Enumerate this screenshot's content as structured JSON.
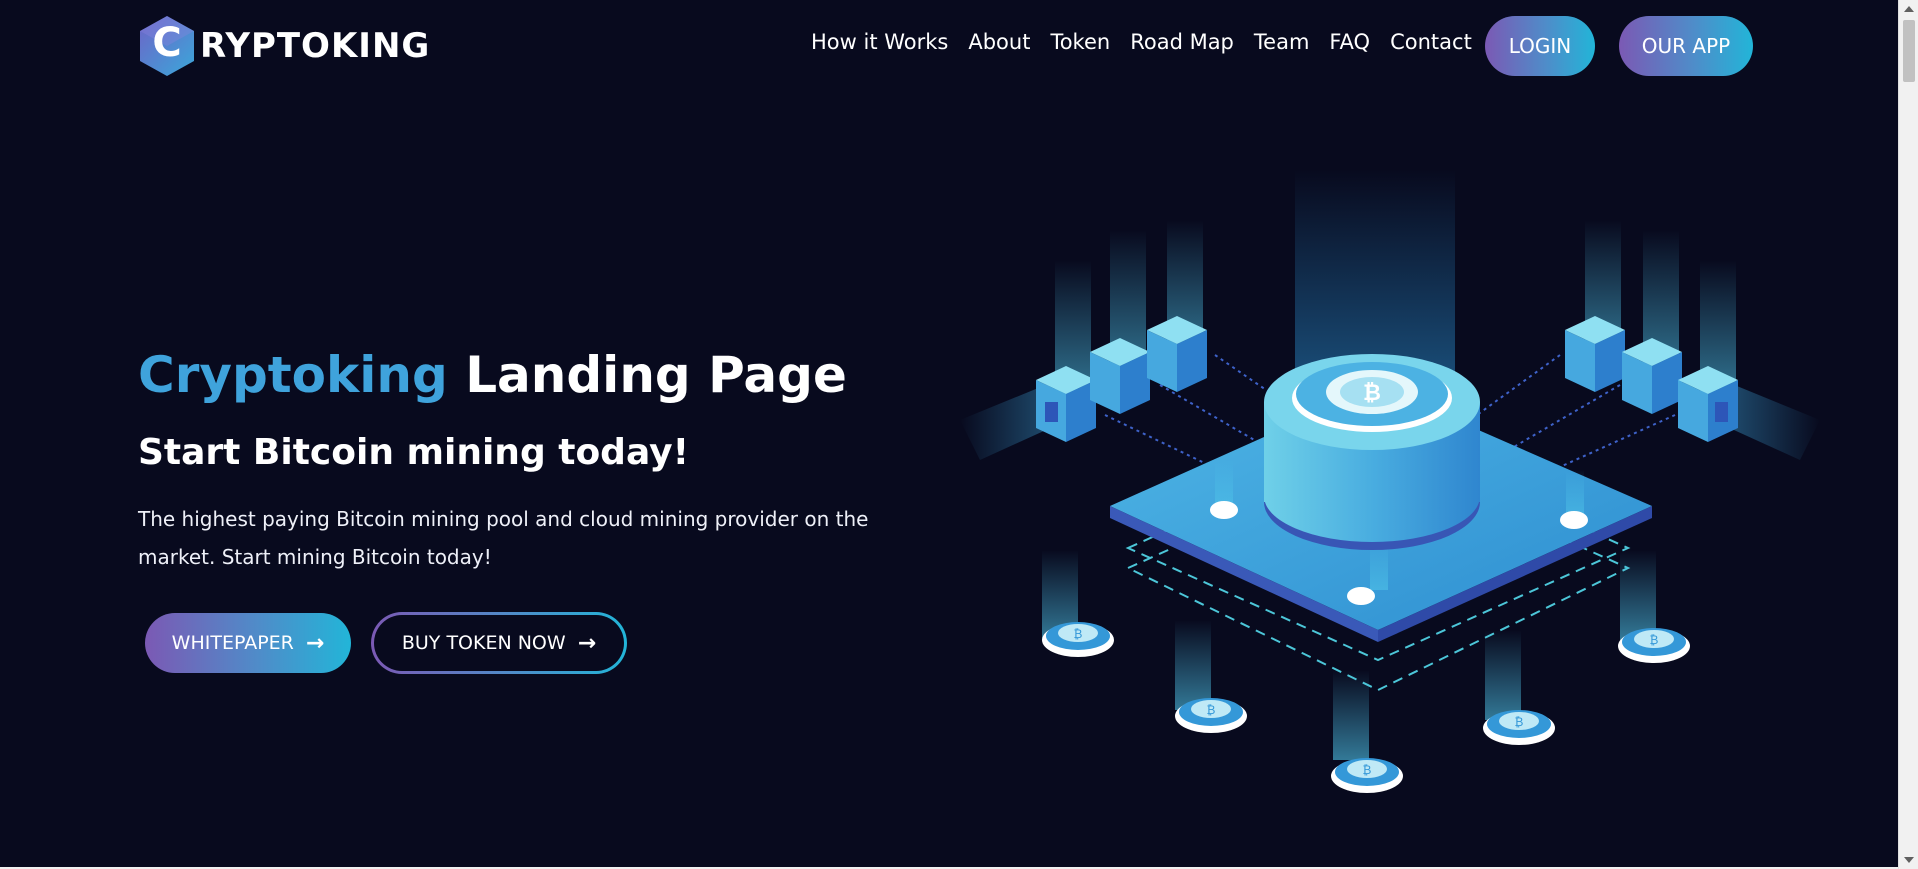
{
  "brand": {
    "logo_letter": "C",
    "name": "RYPTOKING"
  },
  "nav": {
    "items": [
      {
        "label": "How it Works"
      },
      {
        "label": "About"
      },
      {
        "label": "Token"
      },
      {
        "label": "Road Map"
      },
      {
        "label": "Team"
      },
      {
        "label": "FAQ"
      },
      {
        "label": "Contact"
      }
    ],
    "login_label": "LOGIN",
    "app_label": "OUR APP"
  },
  "hero": {
    "title_accent": "Cryptoking",
    "title_rest": "Landing Page",
    "subtitle": "Start Bitcoin mining today!",
    "text": "The highest paying Bitcoin mining pool and cloud mining provider on the market. Start mining Bitcoin today!",
    "whitepaper_label": "WHITEPAPER",
    "buy_label": "BUY TOKEN NOW"
  },
  "colors": {
    "background": "#080a1e",
    "accent_blue": "#3fa3dc",
    "gradient_start": "#7b59b4",
    "gradient_end": "#22b5d8"
  },
  "icons": {
    "arrow": "arrow-right-icon",
    "coin": "bitcoin-icon"
  }
}
